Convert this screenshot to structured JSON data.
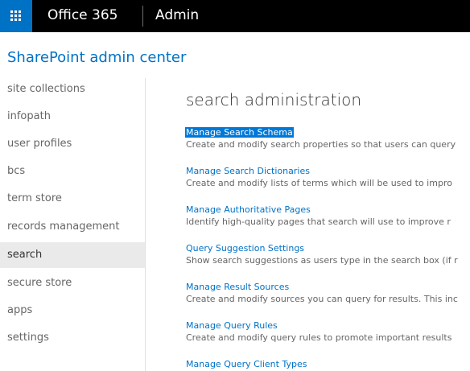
{
  "topbar": {
    "brand": "Office 365",
    "app_name": "Admin",
    "waffle_icon": "app-launcher-icon",
    "colors": {
      "bar": "#000000",
      "waffle_bg": "#0072c6"
    }
  },
  "site_title": "SharePoint admin center",
  "nav": {
    "items": [
      {
        "label": "site collections"
      },
      {
        "label": "infopath"
      },
      {
        "label": "user profiles"
      },
      {
        "label": "bcs"
      },
      {
        "label": "term store"
      },
      {
        "label": "records management"
      },
      {
        "label": "search",
        "selected": true
      },
      {
        "label": "secure store"
      },
      {
        "label": "apps"
      },
      {
        "label": "settings"
      }
    ]
  },
  "main": {
    "title": "search administration",
    "entries": [
      {
        "link": "Manage Search Schema",
        "description": "Create and modify search properties so that users can query",
        "highlighted": true
      },
      {
        "link": "Manage Search Dictionaries",
        "description": "Create and modify lists of terms which will be used to impro"
      },
      {
        "link": "Manage Authoritative Pages",
        "description": "Identify high-quality pages that search will use to improve r"
      },
      {
        "link": "Query Suggestion Settings",
        "description": "Show search suggestions as users type in the search box (if r"
      },
      {
        "link": "Manage Result Sources",
        "description": "Create and modify sources you can query for results. This inc"
      },
      {
        "link": "Manage Query Rules",
        "description": "Create and modify query rules to promote important results"
      },
      {
        "link": "Manage Query Client Types",
        "description": ""
      }
    ]
  },
  "colors": {
    "accent": "#0072c6",
    "selection_highlight": "#0078d7"
  }
}
